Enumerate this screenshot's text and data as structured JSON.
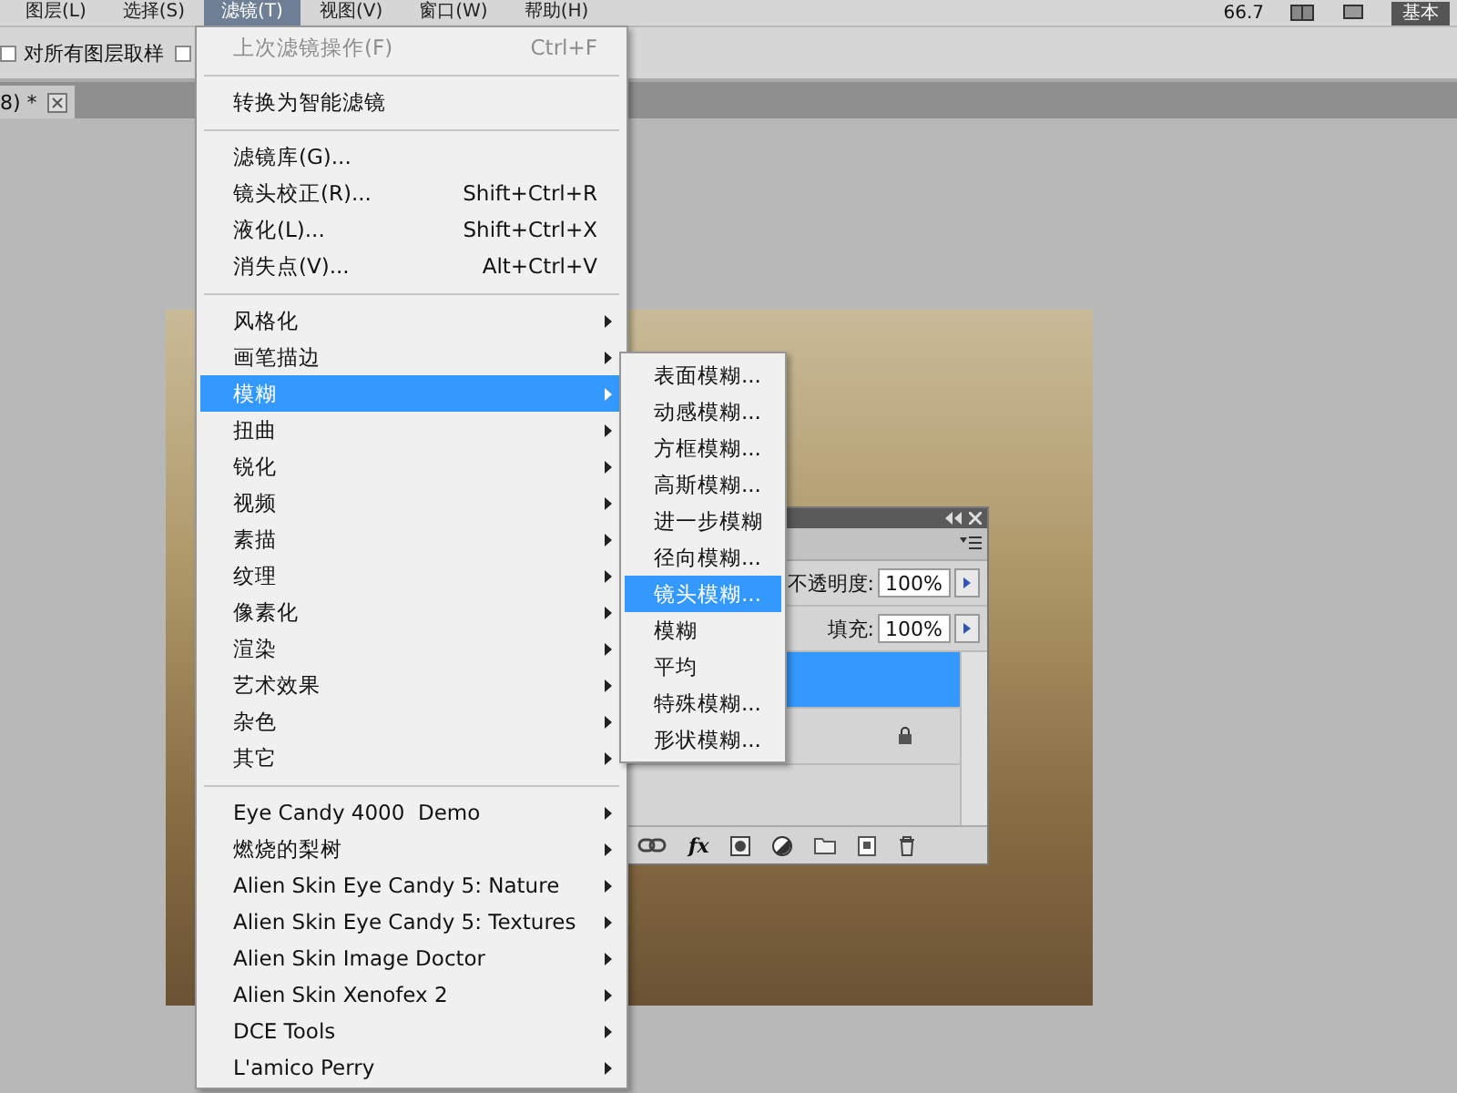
{
  "menubar": [
    {
      "label": "图层(L)",
      "selected": false
    },
    {
      "label": "选择(S)",
      "selected": false
    },
    {
      "label": "滤镜(T)",
      "selected": true
    },
    {
      "label": "视图(V)",
      "selected": false
    },
    {
      "label": "窗口(W)",
      "selected": false
    },
    {
      "label": "帮助(H)",
      "selected": false
    }
  ],
  "toolbar": {
    "zoom": "66.7",
    "workspace": "基本"
  },
  "options_bar": {
    "checkboxes": [
      {
        "label": "对所有图层取样",
        "checked": false
      },
      {
        "checked": false
      }
    ]
  },
  "document_tab": {
    "title": "8) *"
  },
  "filter_menu": [
    [
      {
        "label": "上次滤镜操作(F)",
        "shortcut": "Ctrl+F",
        "disabled": true,
        "submenu": false,
        "selected": false
      }
    ],
    [
      {
        "label": "转换为智能滤镜",
        "disabled": false,
        "submenu": false,
        "selected": false
      }
    ],
    [
      {
        "label": "滤镜库(G)...",
        "disabled": false,
        "submenu": false,
        "selected": false
      },
      {
        "label": "镜头校正(R)...",
        "shortcut": "Shift+Ctrl+R",
        "disabled": false,
        "submenu": false,
        "selected": false
      },
      {
        "label": "液化(L)...",
        "shortcut": "Shift+Ctrl+X",
        "disabled": false,
        "submenu": false,
        "selected": false
      },
      {
        "label": "消失点(V)...",
        "shortcut": "Alt+Ctrl+V",
        "disabled": false,
        "submenu": false,
        "selected": false
      }
    ],
    [
      {
        "label": "风格化",
        "disabled": false,
        "submenu": true,
        "selected": false
      },
      {
        "label": "画笔描边",
        "disabled": false,
        "submenu": true,
        "selected": false
      },
      {
        "label": "模糊",
        "disabled": false,
        "submenu": true,
        "selected": true
      },
      {
        "label": "扭曲",
        "disabled": false,
        "submenu": true,
        "selected": false
      },
      {
        "label": "锐化",
        "disabled": false,
        "submenu": true,
        "selected": false
      },
      {
        "label": "视频",
        "disabled": false,
        "submenu": true,
        "selected": false
      },
      {
        "label": "素描",
        "disabled": false,
        "submenu": true,
        "selected": false
      },
      {
        "label": "纹理",
        "disabled": false,
        "submenu": true,
        "selected": false
      },
      {
        "label": "像素化",
        "disabled": false,
        "submenu": true,
        "selected": false
      },
      {
        "label": "渲染",
        "disabled": false,
        "submenu": true,
        "selected": false
      },
      {
        "label": "艺术效果",
        "disabled": false,
        "submenu": true,
        "selected": false
      },
      {
        "label": "杂色",
        "disabled": false,
        "submenu": true,
        "selected": false
      },
      {
        "label": "其它",
        "disabled": false,
        "submenu": true,
        "selected": false
      }
    ],
    [
      {
        "label": "Eye Candy 4000  Demo",
        "disabled": false,
        "submenu": true,
        "selected": false
      },
      {
        "label": "燃烧的梨树",
        "disabled": false,
        "submenu": true,
        "selected": false
      },
      {
        "label": "Alien Skin Eye Candy 5: Nature",
        "disabled": false,
        "submenu": true,
        "selected": false
      },
      {
        "label": "Alien Skin Eye Candy 5: Textures",
        "disabled": false,
        "submenu": true,
        "selected": false
      },
      {
        "label": "Alien Skin Image Doctor",
        "disabled": false,
        "submenu": true,
        "selected": false
      },
      {
        "label": "Alien Skin Xenofex 2",
        "disabled": false,
        "submenu": true,
        "selected": false
      },
      {
        "label": "DCE Tools",
        "disabled": false,
        "submenu": true,
        "selected": false
      },
      {
        "label": "L'amico Perry",
        "disabled": false,
        "submenu": true,
        "selected": false
      }
    ]
  ],
  "blur_submenu": [
    {
      "label": "表面模糊...",
      "selected": false
    },
    {
      "label": "动感模糊...",
      "selected": false
    },
    {
      "label": "方框模糊...",
      "selected": false
    },
    {
      "label": "高斯模糊...",
      "selected": false
    },
    {
      "label": "进一步模糊",
      "selected": false
    },
    {
      "label": "径向模糊...",
      "selected": false
    },
    {
      "label": "镜头模糊...",
      "selected": true
    },
    {
      "label": "模糊",
      "selected": false
    },
    {
      "label": "平均",
      "selected": false
    },
    {
      "label": "特殊模糊...",
      "selected": false
    },
    {
      "label": "形状模糊...",
      "selected": false
    }
  ],
  "layers_panel": {
    "opacity_label": "不透明度:",
    "opacity": "100%",
    "fill_label": "填充:",
    "fill": "100%",
    "fx": "fx",
    "layers": [
      {
        "selected": true,
        "locked": false
      },
      {
        "selected": false,
        "locked": true
      }
    ]
  }
}
